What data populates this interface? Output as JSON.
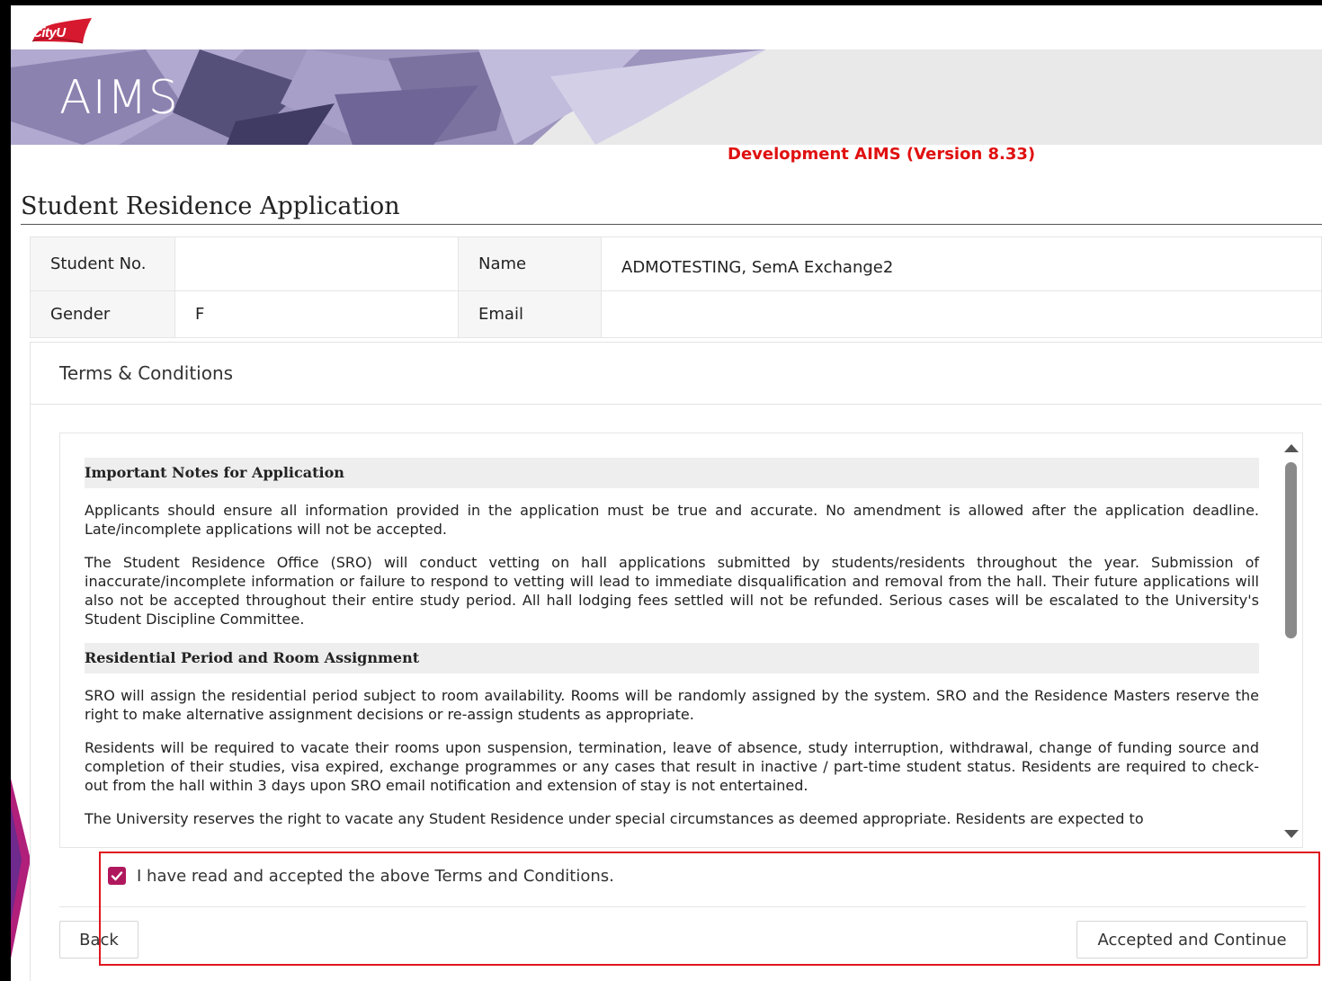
{
  "header": {
    "logo_text": "CityU",
    "app_title": "AIMS",
    "version_banner": "Development AIMS (Version 8.33)"
  },
  "page": {
    "title": "Student Residence Application"
  },
  "student_info": {
    "student_no_label": "Student No.",
    "student_no_value": "",
    "name_label": "Name",
    "name_value": "ADMOTESTING, SemA Exchange2",
    "gender_label": "Gender",
    "gender_value": "F",
    "email_label": "Email",
    "email_value": ""
  },
  "terms": {
    "panel_title": "Terms & Conditions",
    "sections": [
      {
        "heading": "Important Notes for Application",
        "paragraphs": [
          "Applicants should ensure all information provided in the application must be true and accurate. No amendment is allowed after the application deadline. Late/incomplete applications will not be accepted.",
          "The Student Residence Office (SRO) will conduct vetting on hall applications submitted by students/residents throughout the year. Submission of inaccurate/incomplete information or failure to respond to vetting will lead to immediate disqualification and removal from the hall. Their future applications will also not be accepted throughout their entire study period. All hall lodging fees settled will not be refunded. Serious cases will be escalated to the University's Student Discipline Committee."
        ]
      },
      {
        "heading": "Residential Period and Room Assignment",
        "paragraphs": [
          "SRO will assign the residential period subject to room availability. Rooms will be randomly assigned by the system. SRO and the Residence Masters reserve the right to make alternative assignment decisions or re-assign students as appropriate.",
          "Residents will be required to vacate their rooms upon suspension, termination, leave of absence, study interruption, withdrawal, change of funding source and completion of their studies, visa expired, exchange programmes or any cases that result in inactive / part-time student status. Residents are required to check-out from the hall within 3 days upon SRO email notification and extension of stay is not entertained.",
          "The University reserves the right to vacate any Student Residence under special circumstances as deemed appropriate. Residents are expected to"
        ]
      }
    ],
    "accept_label": "I have read and accepted the above Terms and Conditions.",
    "accept_checked": true,
    "checkbox_color": "#b0185d"
  },
  "buttons": {
    "back_label": "Back",
    "accept_label": "Accepted and Continue"
  },
  "colors": {
    "version_text": "#e01010",
    "highlight_border": "#e0161f",
    "logo_red": "#d6192e"
  },
  "icons": {
    "checkbox": "check-icon",
    "scroll_up": "triangle-up-icon",
    "scroll_down": "triangle-down-icon"
  }
}
